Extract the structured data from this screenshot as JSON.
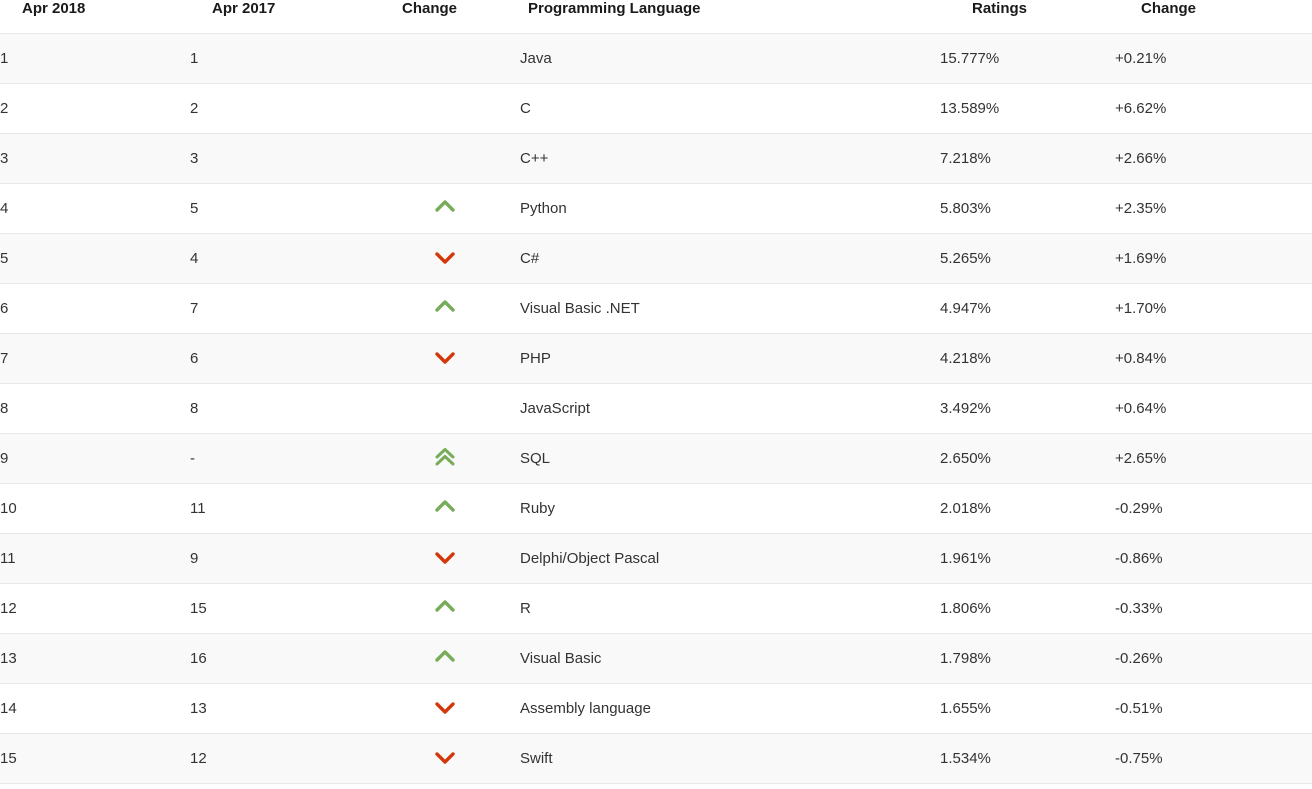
{
  "table": {
    "columns": [
      {
        "key": "rank_now",
        "label": "Apr 2018"
      },
      {
        "key": "rank_prev",
        "label": "Apr 2017"
      },
      {
        "key": "change_dir",
        "label": "Change"
      },
      {
        "key": "language",
        "label": "Programming Language"
      },
      {
        "key": "ratings",
        "label": "Ratings"
      },
      {
        "key": "change_pct",
        "label": "Change"
      }
    ],
    "colors": {
      "up": "#77ac59",
      "down": "#d3380a",
      "row_odd_bg": "#f9f9f9",
      "row_even_bg": "#ffffff",
      "row_border": "#e8e8e8",
      "header_text": "#1a1a1a",
      "body_text": "#333333"
    },
    "rows": [
      {
        "rank_now": "1",
        "rank_prev": "1",
        "change_dir": "none",
        "language": "Java",
        "ratings": "15.777%",
        "change_pct": "+0.21%"
      },
      {
        "rank_now": "2",
        "rank_prev": "2",
        "change_dir": "none",
        "language": "C",
        "ratings": "13.589%",
        "change_pct": "+6.62%"
      },
      {
        "rank_now": "3",
        "rank_prev": "3",
        "change_dir": "none",
        "language": "C++",
        "ratings": "7.218%",
        "change_pct": "+2.66%"
      },
      {
        "rank_now": "4",
        "rank_prev": "5",
        "change_dir": "up",
        "language": "Python",
        "ratings": "5.803%",
        "change_pct": "+2.35%"
      },
      {
        "rank_now": "5",
        "rank_prev": "4",
        "change_dir": "down",
        "language": "C#",
        "ratings": "5.265%",
        "change_pct": "+1.69%"
      },
      {
        "rank_now": "6",
        "rank_prev": "7",
        "change_dir": "up",
        "language": "Visual Basic .NET",
        "ratings": "4.947%",
        "change_pct": "+1.70%"
      },
      {
        "rank_now": "7",
        "rank_prev": "6",
        "change_dir": "down",
        "language": "PHP",
        "ratings": "4.218%",
        "change_pct": "+0.84%"
      },
      {
        "rank_now": "8",
        "rank_prev": "8",
        "change_dir": "none",
        "language": "JavaScript",
        "ratings": "3.492%",
        "change_pct": "+0.64%"
      },
      {
        "rank_now": "9",
        "rank_prev": "-",
        "change_dir": "double-up",
        "language": "SQL",
        "ratings": "2.650%",
        "change_pct": "+2.65%"
      },
      {
        "rank_now": "10",
        "rank_prev": "11",
        "change_dir": "up",
        "language": "Ruby",
        "ratings": "2.018%",
        "change_pct": "-0.29%"
      },
      {
        "rank_now": "11",
        "rank_prev": "9",
        "change_dir": "down",
        "language": "Delphi/Object Pascal",
        "ratings": "1.961%",
        "change_pct": "-0.86%"
      },
      {
        "rank_now": "12",
        "rank_prev": "15",
        "change_dir": "up",
        "language": "R",
        "ratings": "1.806%",
        "change_pct": "-0.33%"
      },
      {
        "rank_now": "13",
        "rank_prev": "16",
        "change_dir": "up",
        "language": "Visual Basic",
        "ratings": "1.798%",
        "change_pct": "-0.26%"
      },
      {
        "rank_now": "14",
        "rank_prev": "13",
        "change_dir": "down",
        "language": "Assembly language",
        "ratings": "1.655%",
        "change_pct": "-0.51%"
      },
      {
        "rank_now": "15",
        "rank_prev": "12",
        "change_dir": "down",
        "language": "Swift",
        "ratings": "1.534%",
        "change_pct": "-0.75%"
      }
    ]
  }
}
